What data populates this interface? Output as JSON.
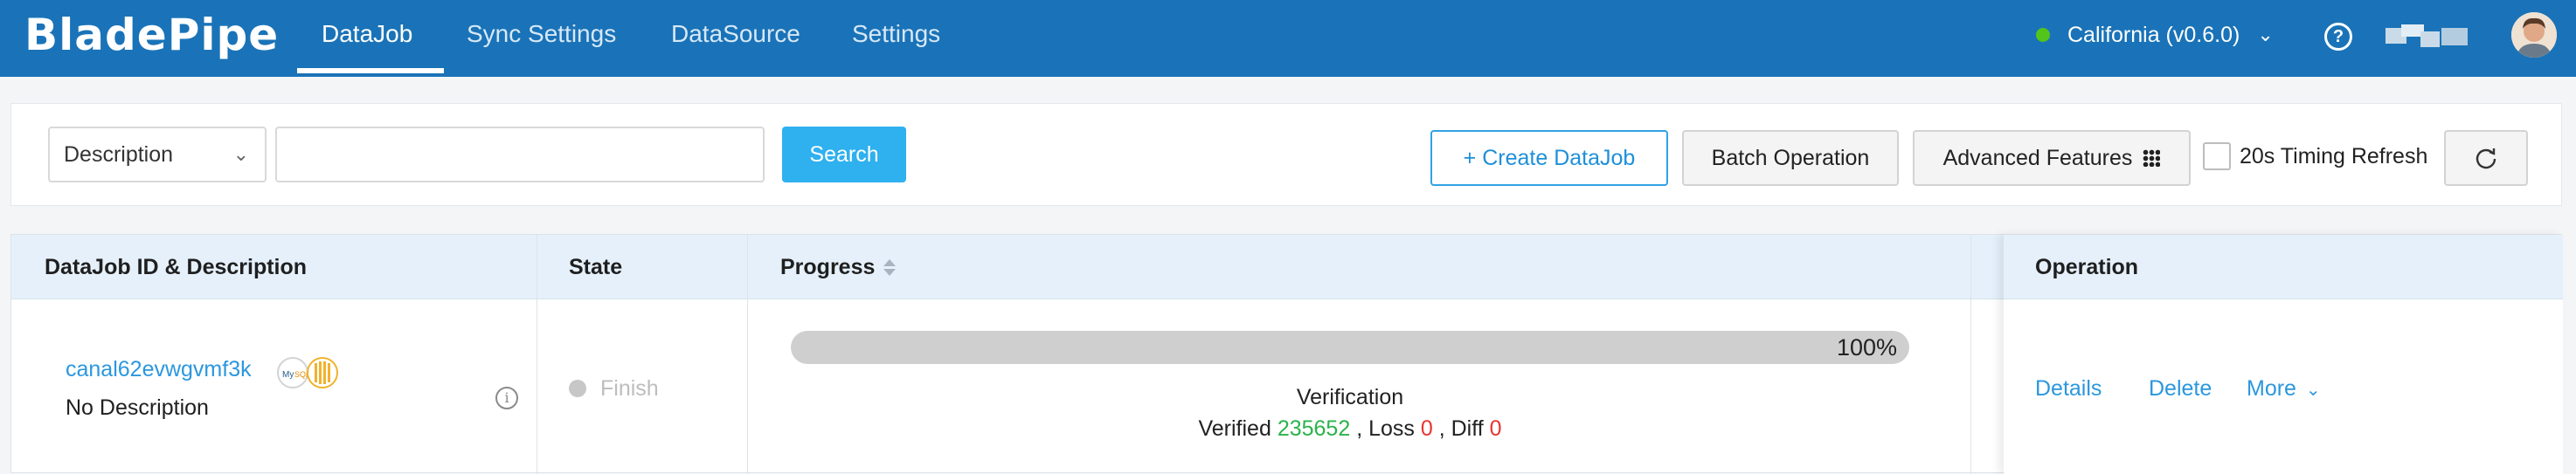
{
  "header": {
    "logo": "BladePipe",
    "nav": [
      "DataJob",
      "Sync Settings",
      "DataSource",
      "Settings"
    ],
    "active_nav": "DataJob",
    "region": "California (v0.6.0)",
    "help": "?"
  },
  "toolbar": {
    "filter_select": "Description",
    "search_value": "",
    "search_label": "Search",
    "create_label": "+ Create DataJob",
    "batch_label": "Batch Operation",
    "advanced_label": "Advanced Features",
    "timing_label": "20s Timing Refresh",
    "timing_checked": false
  },
  "table": {
    "columns": [
      "DataJob ID & Description",
      "State",
      "Progress",
      "Operation"
    ],
    "rows": [
      {
        "job_id": "canal62evwgvmf3k",
        "description": "No Description",
        "state": "Finish",
        "progress_value": 100,
        "progress_label": "100%",
        "phase": "Verification",
        "verified_label": "Verified",
        "verified": "235652",
        "loss_label": ", Loss",
        "loss": "0",
        "diff_label": ", Diff",
        "diff": "0",
        "ops": [
          "Details",
          "Delete",
          "More"
        ]
      }
    ]
  },
  "colors": {
    "topbar": "#1a73b8",
    "accent": "#2fb0ef",
    "link": "#2b97dd",
    "ok": "#2bb24c",
    "bad": "#e8342f"
  }
}
